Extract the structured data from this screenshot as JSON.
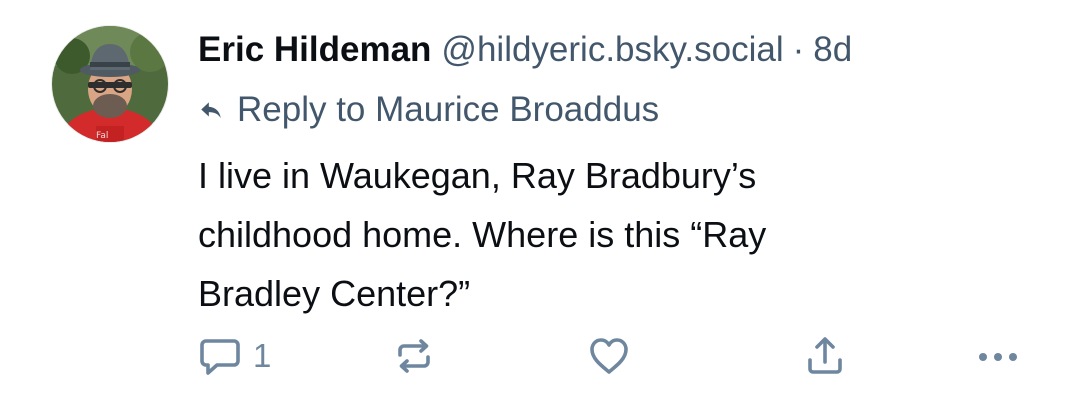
{
  "post": {
    "author": {
      "display_name": "Eric Hildeman",
      "handle": "@hildyeric.bsky.social",
      "avatar_icon": "profile-photo"
    },
    "separator": "·",
    "age": "8d",
    "reply_to": {
      "label": "Reply to Maurice Broaddus",
      "icon": "reply-arrow-icon"
    },
    "text_lines": [
      "I live in Waukegan, Ray Bradbury’s",
      "childhood home. Where is this “Ray",
      "Bradley Center?”"
    ],
    "actions": {
      "reply": {
        "icon": "comment-icon",
        "count": "1"
      },
      "repost": {
        "icon": "repost-icon"
      },
      "like": {
        "icon": "heart-icon"
      },
      "share": {
        "icon": "share-icon"
      },
      "more": {
        "icon": "more-dots-icon"
      }
    }
  },
  "colors": {
    "text_primary": "#0b0f14",
    "text_secondary": "#42576c",
    "icon_color": "#6f869f",
    "background": "#ffffff"
  }
}
